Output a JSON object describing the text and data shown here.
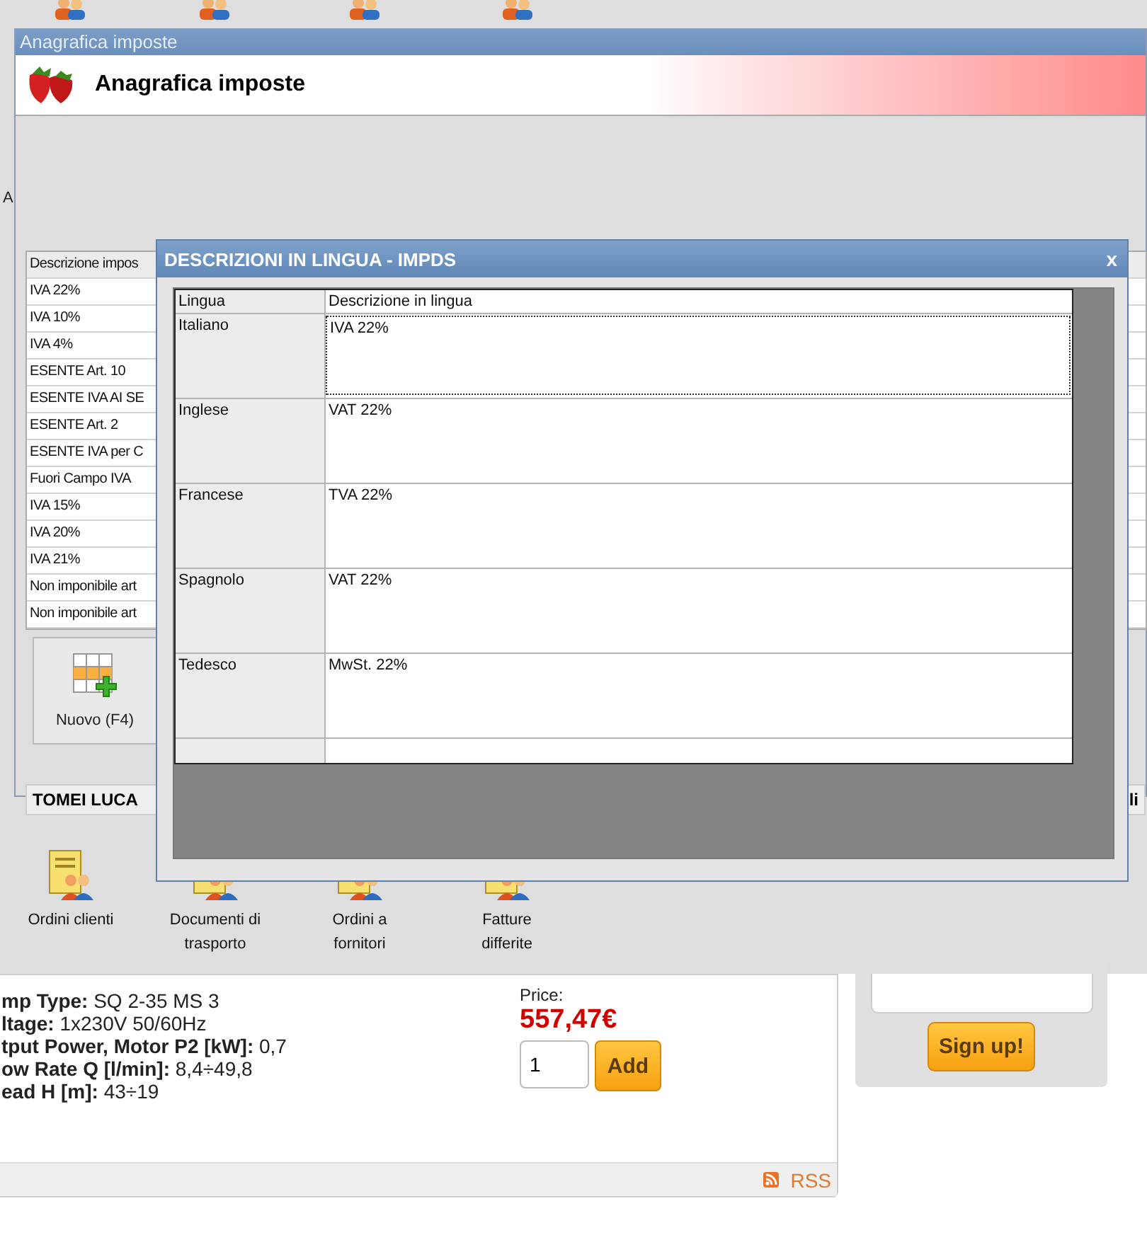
{
  "main_window": {
    "title": "Anagrafica imposte",
    "header_title": "Anagrafica imposte",
    "side_fragment": "A",
    "table": {
      "columns": [
        "Descrizione impos"
      ],
      "rows": [
        "IVA 22%",
        "IVA 10%",
        "IVA 4%",
        "ESENTE Art. 10",
        "ESENTE IVA AI SE",
        "ESENTE Art. 2",
        "ESENTE IVA per C",
        "Fuori Campo IVA",
        "IVA 15%",
        "IVA 20%",
        "IVA 21%",
        "Non imponibile art",
        "Non imponibile art"
      ]
    },
    "new_button": "Nuovo (F4)",
    "status_bar": {
      "user": "TOMEI LUCA",
      "fragment": "li"
    }
  },
  "dialog": {
    "title": "DESCRIZIONI IN LINGUA - IMPDS",
    "close": "x",
    "columns": [
      "Lingua",
      "Descrizione in lingua"
    ],
    "rows": [
      {
        "language": "Italiano",
        "description": "IVA 22%",
        "focused": true
      },
      {
        "language": "Inglese",
        "description": "VAT 22%",
        "focused": false
      },
      {
        "language": "Francese",
        "description": "TVA 22%",
        "focused": false
      },
      {
        "language": "Spagnolo",
        "description": "VAT 22%",
        "focused": false
      },
      {
        "language": "Tedesco",
        "description": "MwSt. 22%",
        "focused": false
      }
    ]
  },
  "desktop_icons": [
    {
      "label": "Ordini clienti"
    },
    {
      "label": "Documenti di trasporto"
    },
    {
      "label": "Ordini a fornitori"
    },
    {
      "label": "Fatture differite"
    }
  ],
  "web_page": {
    "specs": [
      "**mp Type:** SQ 2-35 MS 3",
      "**ltage:** 1x230V 50/60Hz",
      "**tput Power, Motor P2 [kW]:** 0,7",
      "**ow Rate Q [l/min]:** 8,4÷49,8",
      "**ead H [m]:** 43÷19"
    ],
    "price_label": "Price:",
    "price": "557,47€",
    "quantity": "1",
    "add_button": "Add",
    "rss": "RSS",
    "signup_button": "Sign up!"
  }
}
